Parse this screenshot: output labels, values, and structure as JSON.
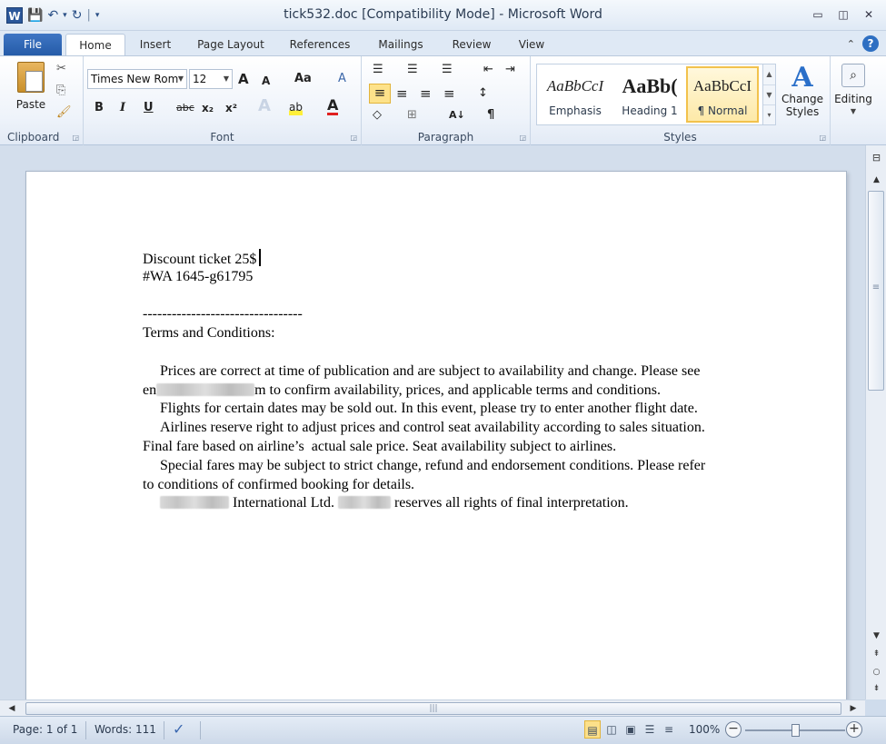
{
  "app": {
    "title": "tick532.doc [Compatibility Mode]  -  Microsoft Word",
    "word_icon": "W"
  },
  "qat": {
    "save": "💾",
    "undo": "↶",
    "undo_dd": "▾",
    "redo": "↻",
    "customize": "▾"
  },
  "window_controls": {
    "minimize": "▭",
    "restore": "◫",
    "close": "✕"
  },
  "tabs": [
    "File",
    "Home",
    "Insert",
    "Page Layout",
    "References",
    "Mailings",
    "Review",
    "View"
  ],
  "ribbon": {
    "clipboard": {
      "label": "Clipboard",
      "paste": "Paste"
    },
    "font": {
      "label": "Font",
      "name": "Times New Rom",
      "size": "12",
      "grow": "A",
      "shrink": "A",
      "case": "Aa",
      "clear": "A",
      "bold": "B",
      "italic": "I",
      "underline": "U",
      "strike": "abc",
      "subscript": "x₂",
      "superscript": "x²",
      "effects": "A",
      "highlight": "ab",
      "color": "A"
    },
    "paragraph": {
      "label": "Paragraph",
      "bullets": "☰",
      "numbering": "☰",
      "multilevel": "☰",
      "dec_indent": "⇤",
      "inc_indent": "⇥",
      "align_left": "≡",
      "center": "≡",
      "right": "≡",
      "justify": "≡",
      "spacing": "↕",
      "shading": "◇",
      "borders": "⊞",
      "sort": "A↓",
      "pilcrow": "¶"
    },
    "styles": {
      "label": "Styles",
      "items": [
        {
          "sample": "AaBbCcI",
          "name": "Emphasis"
        },
        {
          "sample": "AaBb(",
          "name": "Heading 1"
        },
        {
          "sample": "AaBbCcI",
          "name": "¶ Normal"
        }
      ],
      "change_styles": "Change Styles",
      "change_styles_line1": "Change",
      "change_styles_line2": "Styles"
    },
    "editing": {
      "label": "Editing"
    }
  },
  "document": {
    "lines": [
      {
        "text": "Discount ticket 25$",
        "type": "plain"
      },
      {
        "text": "#WA 1645-g61795",
        "type": "plain"
      },
      {
        "text": "",
        "type": "plain"
      },
      {
        "text": "---------------------------------",
        "type": "plain"
      },
      {
        "text": "Terms and Conditions:",
        "type": "plain"
      },
      {
        "text": "",
        "type": "plain"
      },
      {
        "text": "Prices are correct at time of publication and are subject to availability and change. Please see",
        "type": "indent"
      },
      {
        "text_a": "en",
        "text_b": "m to confirm availability, prices, and applicable terms and conditions.",
        "type": "redacted1"
      },
      {
        "text": "Flights for certain dates may be sold out. In this event, please try to enter another flight date.",
        "type": "indent"
      },
      {
        "text": "Airlines reserve right to adjust prices and control seat availability according to sales situation.",
        "type": "indent"
      },
      {
        "text": "Final fare based on airline’s  actual sale price. Seat availability subject to airlines.",
        "type": "plain"
      },
      {
        "text": "Special fares may be subject to strict change, refund and endorsement conditions. Please refer",
        "type": "indent"
      },
      {
        "text": "to conditions of confirmed booking for details.",
        "type": "plain"
      },
      {
        "text_a": " International Ltd. ",
        "text_b": " reserves all rights of final interpretation.",
        "type": "redacted2"
      }
    ]
  },
  "status": {
    "page": "Page: 1 of 1",
    "words": "Words: 111",
    "zoom": "100%",
    "zoom_out": "−",
    "zoom_in": "+"
  }
}
